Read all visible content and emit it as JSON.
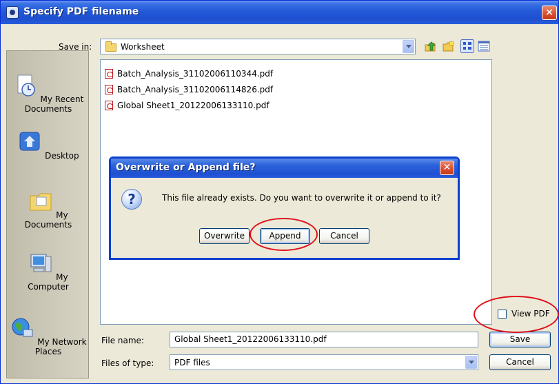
{
  "window": {
    "title": "Specify PDF filename",
    "close_glyph": "✕"
  },
  "save_in": {
    "label": "Save in:",
    "value": "Worksheet",
    "icon": "folder-icon"
  },
  "toolbar": {
    "icons": [
      "up-folder-icon",
      "new-folder-icon",
      "list-view-icon",
      "details-view-icon"
    ]
  },
  "places": [
    {
      "label_line1": "My Recent",
      "label_line2": "Documents",
      "icon": "recent-documents-icon"
    },
    {
      "label_line1": "Desktop",
      "label_line2": "",
      "icon": "desktop-icon"
    },
    {
      "label_line1": "My Documents",
      "label_line2": "",
      "icon": "my-documents-icon"
    },
    {
      "label_line1": "My Computer",
      "label_line2": "",
      "icon": "my-computer-icon"
    },
    {
      "label_line1": "My Network",
      "label_line2": "Places",
      "icon": "network-places-icon"
    }
  ],
  "files": [
    "Batch_Analysis_31102006110344.pdf",
    "Batch_Analysis_31102006114826.pdf",
    "Global Sheet1_20122006133110.pdf"
  ],
  "dialog": {
    "title": "Overwrite or Append file?",
    "message": "This file already exists. Do you want to overwrite it or append to it?",
    "icon": "question-icon",
    "buttons": {
      "overwrite": "Overwrite",
      "append": "Append",
      "cancel": "Cancel"
    }
  },
  "view_pdf": {
    "label": "View PDF",
    "checked": false
  },
  "file_name": {
    "label": "File name:",
    "value": "Global Sheet1_20122006133110.pdf"
  },
  "file_type": {
    "label": "Files of type:",
    "value": "PDF files"
  },
  "buttons": {
    "save": "Save",
    "cancel": "Cancel"
  },
  "colors": {
    "titlebar": "#2359d8",
    "dialog_bg": "#ece9d8",
    "highlight_ring": "#e0101a"
  }
}
